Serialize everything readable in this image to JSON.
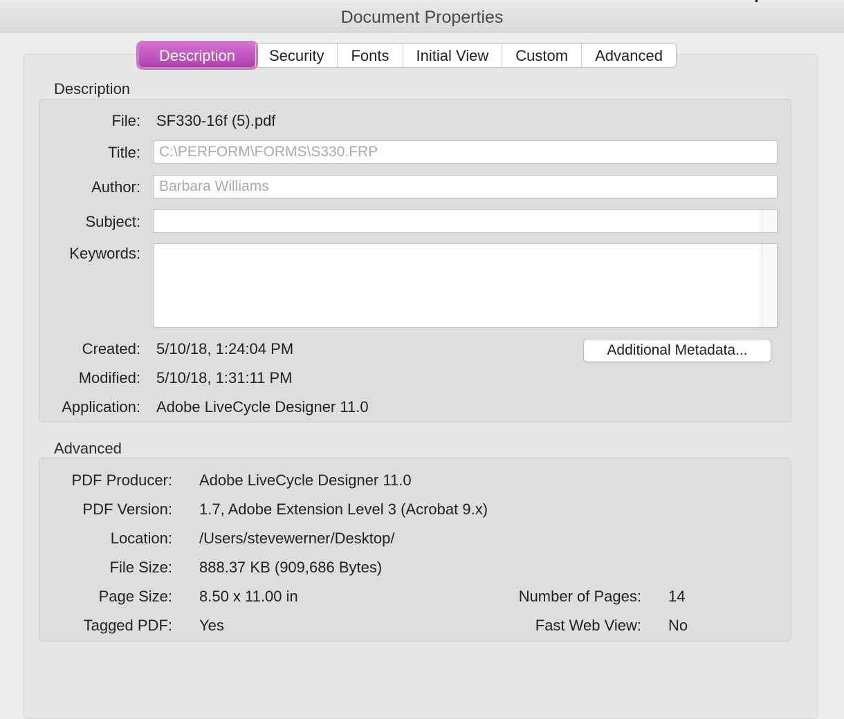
{
  "window": {
    "title": "Document Properties"
  },
  "tabs": [
    {
      "label": "Description"
    },
    {
      "label": "Security"
    },
    {
      "label": "Fonts"
    },
    {
      "label": "Initial View"
    },
    {
      "label": "Custom"
    },
    {
      "label": "Advanced"
    }
  ],
  "active_tab": "Description",
  "description": {
    "section_label": "Description",
    "file": {
      "label": "File:",
      "value": "SF330-16f (5).pdf"
    },
    "title": {
      "label": "Title:",
      "value": "C:\\PERFORM\\FORMS\\S330.FRP"
    },
    "author": {
      "label": "Author:",
      "value": "Barbara Williams"
    },
    "subject": {
      "label": "Subject:",
      "value": ""
    },
    "keywords": {
      "label": "Keywords:",
      "value": ""
    },
    "created": {
      "label": "Created:",
      "value": "5/10/18, 1:24:04 PM"
    },
    "modified": {
      "label": "Modified:",
      "value": "5/10/18, 1:31:11 PM"
    },
    "application": {
      "label": "Application:",
      "value": "Adobe LiveCycle Designer 11.0"
    },
    "metadata_button": "Additional Metadata..."
  },
  "advanced": {
    "section_label": "Advanced",
    "pdf_producer": {
      "label": "PDF Producer:",
      "value": "Adobe LiveCycle Designer 11.0"
    },
    "pdf_version": {
      "label": "PDF Version:",
      "value": "1.7, Adobe Extension Level 3 (Acrobat 9.x)"
    },
    "location": {
      "label": "Location:",
      "value": "/Users/stevewerner/Desktop/"
    },
    "file_size": {
      "label": "File Size:",
      "value": "888.37 KB (909,686 Bytes)"
    },
    "page_size": {
      "label": "Page Size:",
      "value": "8.50 x 11.00 in"
    },
    "tagged_pdf": {
      "label": "Tagged PDF:",
      "value": "Yes"
    },
    "number_of_pages": {
      "label": "Number of Pages:",
      "value": "14"
    },
    "fast_web_view": {
      "label": "Fast Web View:",
      "value": "No"
    }
  },
  "colors": {
    "accent": "#b84fb5",
    "window_bg": "#ececec",
    "group_bg": "#dedede"
  }
}
